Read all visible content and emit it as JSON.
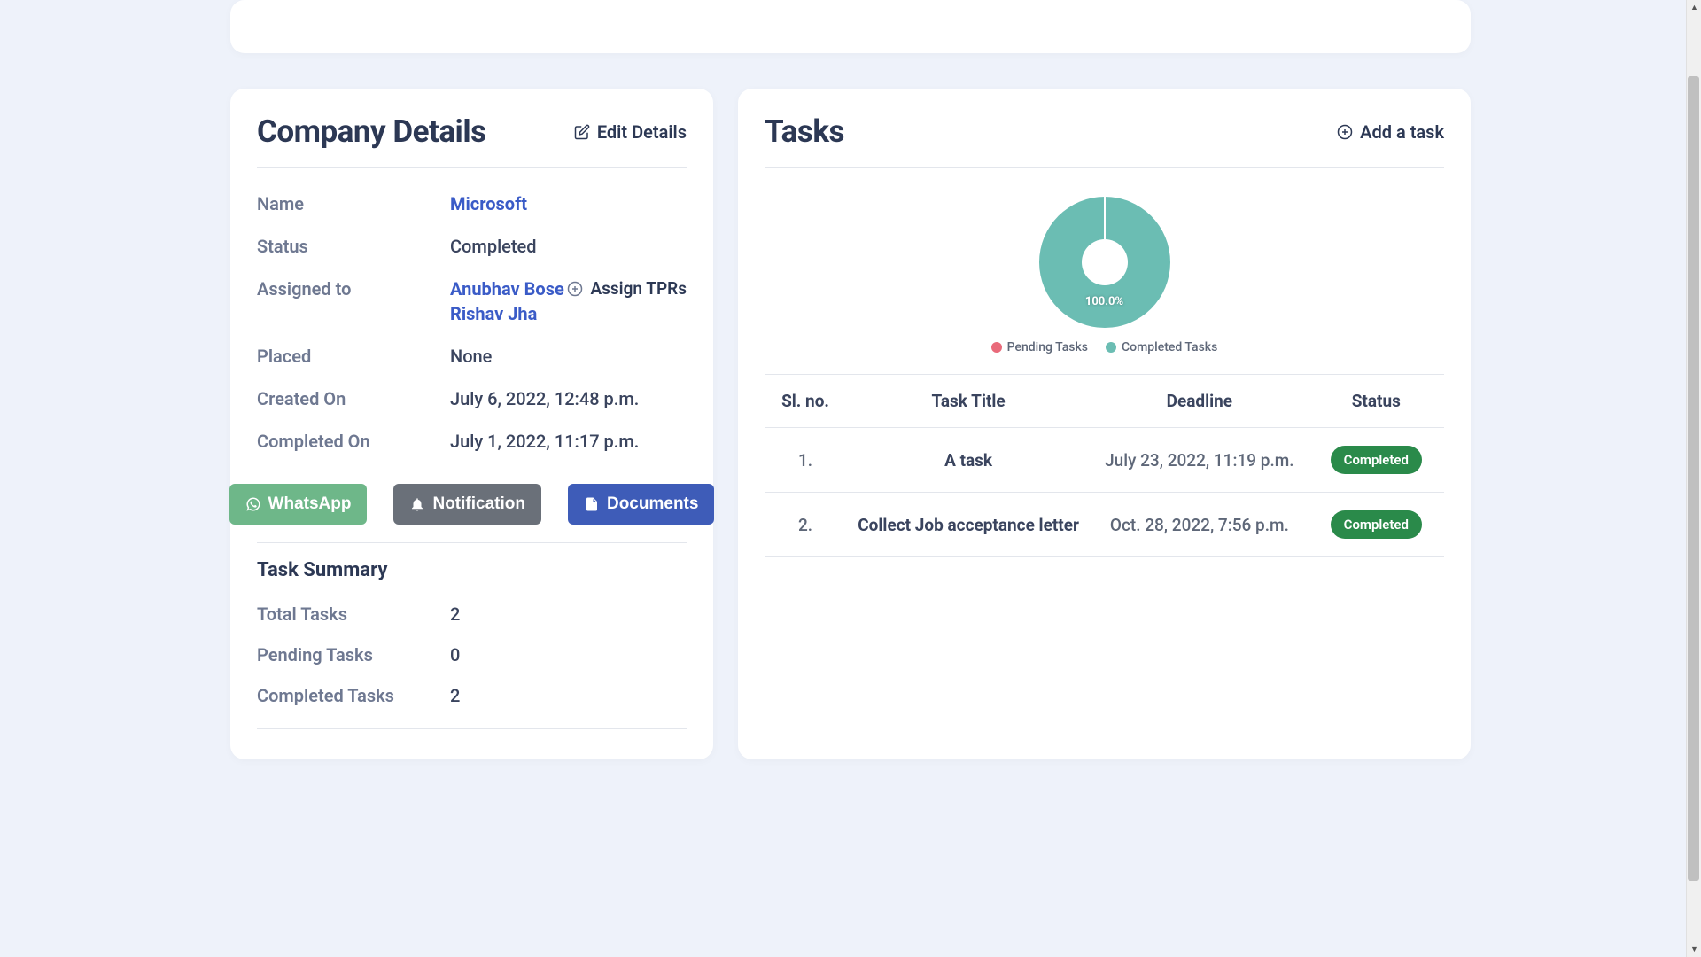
{
  "company": {
    "title": "Company Details",
    "edit_label": "Edit Details",
    "fields": {
      "name_label": "Name",
      "name_value": "Microsoft",
      "status_label": "Status",
      "status_value": "Completed",
      "assigned_label": "Assigned to",
      "assigned_value_1": "Anubhav Bose",
      "assigned_value_2": "Rishav Jha",
      "assign_tprs_label": "Assign TPRs",
      "placed_label": "Placed",
      "placed_value": "None",
      "created_label": "Created On",
      "created_value": "July 6, 2022, 12:48 p.m.",
      "completed_label": "Completed On",
      "completed_value": "July 1, 2022, 11:17 p.m."
    },
    "buttons": {
      "whatsapp": "WhatsApp",
      "notification": "Notification",
      "documents": "Documents"
    },
    "summary": {
      "title": "Task Summary",
      "total_label": "Total Tasks",
      "total_value": "2",
      "pending_label": "Pending Tasks",
      "pending_value": "0",
      "completed_label": "Completed Tasks",
      "completed_value": "2"
    }
  },
  "tasks": {
    "title": "Tasks",
    "add_label": "Add a task",
    "chart_percent": "100.0%",
    "legend_pending": "Pending Tasks",
    "legend_completed": "Completed Tasks",
    "columns": {
      "sl": "Sl. no.",
      "title": "Task Title",
      "deadline": "Deadline",
      "status": "Status"
    },
    "rows": [
      {
        "sl": "1.",
        "title": "A task",
        "deadline": "July 23, 2022, 11:19 p.m.",
        "status": "Completed"
      },
      {
        "sl": "2.",
        "title": "Collect Job acceptance letter",
        "deadline": "Oct. 28, 2022, 7:56 p.m.",
        "status": "Completed"
      }
    ]
  },
  "chart_data": {
    "type": "pie",
    "title": "Tasks",
    "series": [
      {
        "name": "Pending Tasks",
        "value": 0,
        "color": "#e96a7a"
      },
      {
        "name": "Completed Tasks",
        "value": 2,
        "color": "#6bbdb3"
      }
    ],
    "total": 2,
    "percent_label": "100.0%"
  },
  "colors": {
    "accent_blue": "#3e5cb8",
    "accent_green": "#6eb789",
    "accent_gray": "#6a7079",
    "badge_green": "#2a8a4a",
    "chart_teal": "#6bbdb3",
    "chart_pink": "#e96a7a"
  }
}
